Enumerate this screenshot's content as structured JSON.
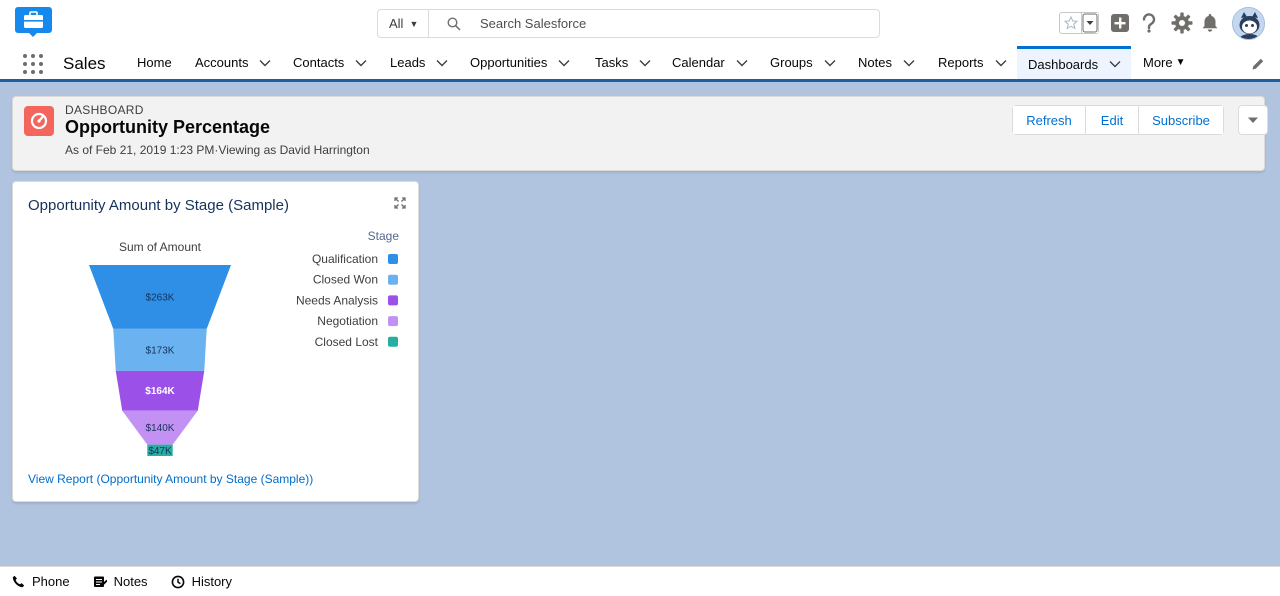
{
  "header": {
    "search_scope": "All",
    "search_placeholder": "Search Salesforce"
  },
  "nav": {
    "app_name": "Sales",
    "items": [
      {
        "label": "Home",
        "has_menu": false
      },
      {
        "label": "Accounts",
        "has_menu": true
      },
      {
        "label": "Contacts",
        "has_menu": true
      },
      {
        "label": "Leads",
        "has_menu": true
      },
      {
        "label": "Opportunities",
        "has_menu": true
      },
      {
        "label": "Tasks",
        "has_menu": true
      },
      {
        "label": "Calendar",
        "has_menu": true
      },
      {
        "label": "Groups",
        "has_menu": true
      },
      {
        "label": "Notes",
        "has_menu": true
      },
      {
        "label": "Reports",
        "has_menu": true
      },
      {
        "label": "Dashboards",
        "has_menu": true,
        "active": true
      }
    ],
    "more_label": "More"
  },
  "dashboard": {
    "type_label": "DASHBOARD",
    "title": "Opportunity Percentage",
    "meta": "As of Feb 21, 2019 1:23 PM·Viewing as David Harrington",
    "buttons": {
      "refresh": "Refresh",
      "edit": "Edit",
      "subscribe": "Subscribe"
    }
  },
  "widget": {
    "title": "Opportunity Amount by Stage (Sample)",
    "view_report": "View Report (Opportunity Amount by Stage (Sample))"
  },
  "chart_data": {
    "type": "funnel",
    "title": "Sum of Amount",
    "legend_title": "Stage",
    "legend_position": "right",
    "categories": [
      "Qualification",
      "Closed Won",
      "Needs Analysis",
      "Negotiation",
      "Closed Lost"
    ],
    "values": [
      263,
      173,
      164,
      140,
      47
    ],
    "labels": [
      "$263K",
      "$173K",
      "$164K",
      "$140K",
      "$47K"
    ],
    "colors": [
      "#2f8fe6",
      "#6ab3f0",
      "#9b51e8",
      "#c391f3",
      "#26aea3"
    ]
  },
  "utility_bar": {
    "items": [
      "Phone",
      "Notes",
      "History"
    ]
  },
  "colors": {
    "brand": "#0070d2",
    "dashboard_icon": "#f2665e",
    "nav_border": "#1b5f9e"
  }
}
